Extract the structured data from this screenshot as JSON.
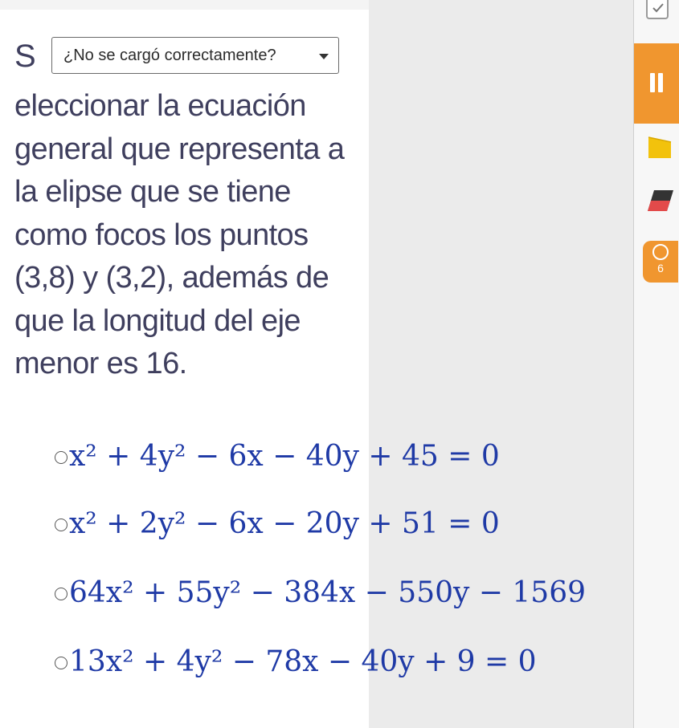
{
  "header": {
    "lead_letter": "S",
    "dropdown_label": "¿No se cargó correctamente?"
  },
  "question": {
    "text": "eleccionar la ecuación general que representa a la elipse que se tiene como focos los puntos (3,8) y (3,2), además de que la longitud del eje menor es 16."
  },
  "options": [
    "x² + 4y² − 6x − 40y + 45 = 0",
    "x² + 2y² − 6x − 20y + 51 = 0",
    "64x² + 55y² − 384x − 550y − 1569",
    "13x² + 4y² − 78x − 40y + 9 = 0"
  ],
  "toolbar": {
    "badge_count": "6",
    "accent_color": "#f0962f",
    "highlighter_color": "#f2c20c",
    "icons": [
      "check-icon",
      "pause-icon",
      "highlighter-icon",
      "eraser-icon",
      "timer-icon"
    ]
  }
}
